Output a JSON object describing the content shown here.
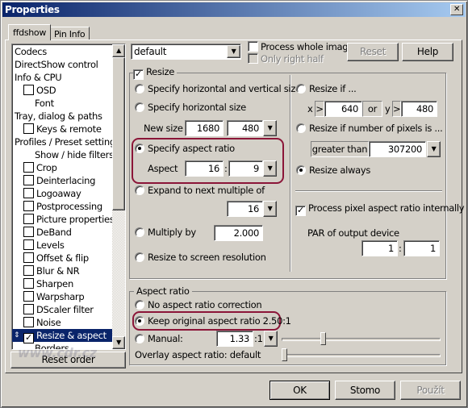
{
  "window": {
    "title": "Properties",
    "close_label": "✕"
  },
  "tabs": [
    {
      "label": "ffdshow",
      "active": true
    },
    {
      "label": "Pin Info",
      "active": false
    }
  ],
  "tree": {
    "items": [
      {
        "label": "Codecs",
        "indent": 0
      },
      {
        "label": "DirectShow control",
        "indent": 0
      },
      {
        "label": "Info & CPU",
        "indent": 0
      },
      {
        "label": "OSD",
        "indent": 1,
        "checkbox": true,
        "checked": false
      },
      {
        "label": "Font",
        "indent": 2
      },
      {
        "label": "Tray, dialog & paths",
        "indent": 0
      },
      {
        "label": "Keys & remote",
        "indent": 1,
        "checkbox": true,
        "checked": false
      },
      {
        "label": "Profiles / Preset settings",
        "indent": 0
      },
      {
        "label": "Show / hide filters",
        "indent": 2
      },
      {
        "label": "Crop",
        "indent": 1,
        "checkbox": true,
        "checked": false
      },
      {
        "label": "Deinterlacing",
        "indent": 1,
        "checkbox": true,
        "checked": false
      },
      {
        "label": "Logoaway",
        "indent": 1,
        "checkbox": true,
        "checked": false
      },
      {
        "label": "Postprocessing",
        "indent": 1,
        "checkbox": true,
        "checked": false
      },
      {
        "label": "Picture properties",
        "indent": 1,
        "checkbox": true,
        "checked": false
      },
      {
        "label": "DeBand",
        "indent": 1,
        "checkbox": true,
        "checked": false
      },
      {
        "label": "Levels",
        "indent": 1,
        "checkbox": true,
        "checked": false
      },
      {
        "label": "Offset & flip",
        "indent": 1,
        "checkbox": true,
        "checked": false
      },
      {
        "label": "Blur & NR",
        "indent": 1,
        "checkbox": true,
        "checked": false
      },
      {
        "label": "Sharpen",
        "indent": 1,
        "checkbox": true,
        "checked": false
      },
      {
        "label": "Warpsharp",
        "indent": 1,
        "checkbox": true,
        "checked": false
      },
      {
        "label": "DScaler filter",
        "indent": 1,
        "checkbox": true,
        "checked": false
      },
      {
        "label": "Noise",
        "indent": 1,
        "checkbox": true,
        "checked": false
      },
      {
        "label": "Resize & aspect",
        "indent": 1,
        "checkbox": true,
        "checked": true,
        "selected": true
      },
      {
        "label": "Borders",
        "indent": 2
      }
    ],
    "reset_order": "Reset order"
  },
  "preset": {
    "value": "default"
  },
  "process_whole_image": {
    "label": "Process whole image",
    "checked": false
  },
  "only_right_half": {
    "label": "Only right half",
    "checked": false,
    "disabled": true
  },
  "buttons": {
    "reset": "Reset",
    "help": "Help",
    "ok": "OK",
    "cancel": "Stomo",
    "apply": "Použít"
  },
  "resize": {
    "label": "Resize",
    "checked": true,
    "opt_hv": "Specify horizontal and vertical size",
    "opt_h": "Specify horizontal size",
    "new_size_label": "New size",
    "new_w": "1680",
    "new_h": "480",
    "opt_aspect": "Specify aspect ratio",
    "aspect_label": "Aspect",
    "aspect_x": "16",
    "aspect_y": "9",
    "colon": ":",
    "opt_expand": "Expand to next multiple of",
    "expand_value": "16",
    "opt_multiply": "Multiply by",
    "multiply_value": "2.000",
    "opt_screen": "Resize to screen resolution",
    "selected": "Specify aspect ratio",
    "resize_if": "Resize if ...",
    "x_label": "x",
    "gt": ">",
    "x_value": "640",
    "or": "or",
    "y_label": "y",
    "y_value": "480",
    "resize_if_pixels": "Resize if number of pixels is ...",
    "pixels_cmp": "greater than",
    "pixels_value": "307200",
    "resize_always": "Resize always",
    "condition_selected": "Resize always",
    "par_internal": {
      "label": "Process pixel aspect ratio internally",
      "checked": true
    },
    "par_label": "PAR of output device",
    "par_x": "1",
    "par_y": "1"
  },
  "aspect_ratio": {
    "title": "Aspect ratio",
    "opt_none": "No aspect ratio correction",
    "opt_keep": "Keep original aspect ratio 2.50:1",
    "opt_manual": "Manual:",
    "manual_value": "1.33",
    "manual_suffix": ":1",
    "selected": "Keep original aspect ratio 2.50:1",
    "manual_slider": 0.25,
    "overlay_label": "Overlay aspect ratio: default",
    "overlay_slider": 0
  },
  "highlight_color": "#8b1538",
  "watermark": "www.cdr.cz"
}
